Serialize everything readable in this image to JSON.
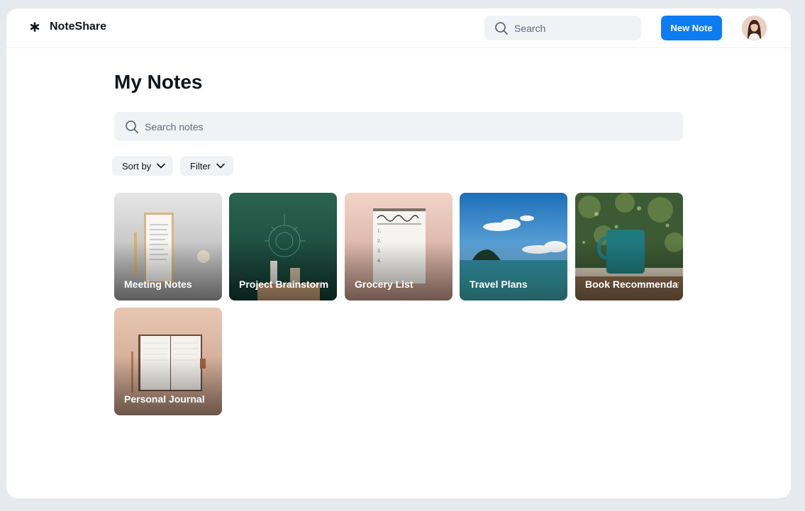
{
  "app": {
    "name": "NoteShare",
    "logo_icon": "asterisk-logo-icon"
  },
  "header": {
    "search_placeholder": "Search",
    "new_note_label": "New Note",
    "avatar_icon": "user-avatar"
  },
  "page": {
    "title": "My Notes",
    "search_placeholder": "Search notes",
    "sort_label": "Sort by",
    "filter_label": "Filter"
  },
  "notes": [
    {
      "title": "Meeting Notes"
    },
    {
      "title": "Project Brainstorm"
    },
    {
      "title": "Grocery List"
    },
    {
      "title": "Travel Plans"
    },
    {
      "title": "Book Recommendations"
    },
    {
      "title": "Personal Journal"
    }
  ],
  "colors": {
    "accent": "#0d7cf2",
    "surface": "#f0f2f5",
    "background": "#e6e9ee"
  }
}
